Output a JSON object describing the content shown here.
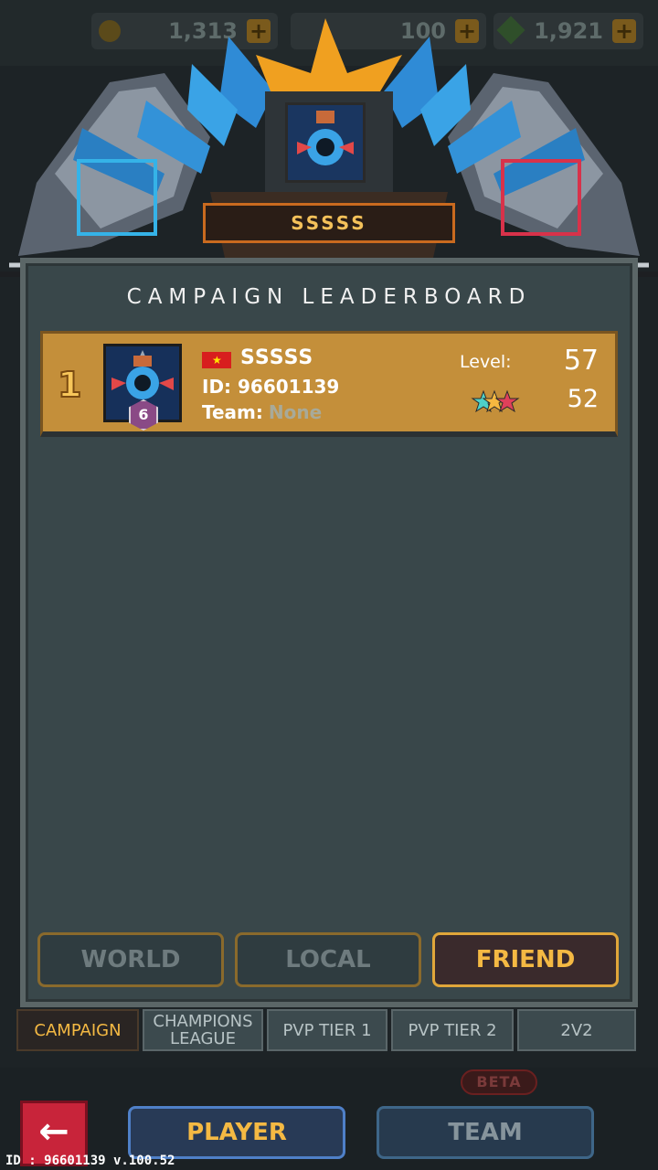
{
  "topbar": {
    "gold": "1,313",
    "energy": "100",
    "gems": "1,921"
  },
  "header": {
    "player_name": "SSSSS"
  },
  "panel": {
    "title": "CAMPAIGN LEADERBOARD"
  },
  "leaderboard": {
    "rows": [
      {
        "rank": "1",
        "name": "SSSSS",
        "id_label": "ID: 96601139",
        "team_label": "Team:",
        "team_value": "None",
        "badge": "6",
        "level_label": "Level:",
        "level_value": "57",
        "stars_value": "52"
      }
    ]
  },
  "filters": {
    "world": "WORLD",
    "local": "LOCAL",
    "friend": "FRIEND",
    "selected": "FRIEND"
  },
  "tabs": {
    "campaign": "CAMPAIGN",
    "champions": "CHAMPIONS LEAGUE",
    "pvp1": "PVP TIER 1",
    "pvp2": "PVP TIER 2",
    "twovtwo": "2V2",
    "selected": "CAMPAIGN"
  },
  "bottom": {
    "beta": "BETA",
    "player": "PLAYER",
    "team": "TEAM",
    "footer": "ID : 96601139 v.100.52"
  },
  "colors": {
    "accent": "#f4b943",
    "row_gold": "#c48f3a",
    "panel": "#39474a"
  }
}
